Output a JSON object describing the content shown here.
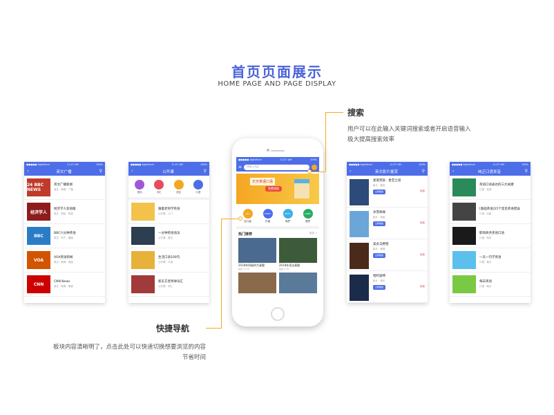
{
  "header": {
    "title": "首页页面展示",
    "subtitle": "HOME PAGE AND PAGE DISPLAY"
  },
  "annotations": {
    "search_title": "搜索",
    "search_desc_1": "用户可以在此输入关键词搜索或者开启语音输入",
    "search_desc_2": "极大提高搜索效率",
    "nav_title": "快捷导航",
    "nav_desc_1": "板块内容清晰明了，点击此处可以快速切换想要浏览的内容",
    "nav_desc_2": "节省时间"
  },
  "screen1": {
    "title": "英文广播",
    "status_left": "●●●●● Applelium",
    "status_time": "11:27 AM",
    "status_right": "100%",
    "items": [
      {
        "thumb": "24 BBC NEWS",
        "name": "英文广播新闻",
        "meta": "英文 · 新闻 · 广播",
        "color": "#c0392b"
      },
      {
        "thumb": "经济学人",
        "name": "经济学人双语版",
        "meta": "英文 · 财经 · 双语",
        "color": "#8e1c1c"
      },
      {
        "thumb": "BBC",
        "name": "BBC六分钟英语",
        "meta": "英文 · 听力 · 慢速",
        "color": "#2a7cc7"
      },
      {
        "thumb": "VOA",
        "name": "VOA英语新闻",
        "meta": "英文 · 新闻 · 常速",
        "color": "#d35400"
      },
      {
        "thumb": "CNN",
        "name": "CNN News",
        "meta": "英文 · 新闻 · 常速",
        "color": "#cc0000"
      }
    ]
  },
  "screen2": {
    "title": "公开课",
    "cats": [
      "音标",
      "词汇",
      "语法",
      "口语"
    ],
    "items": [
      {
        "name": "跟着老师学英语",
        "meta": "公开课 · 入门",
        "color": "#f3c24a"
      },
      {
        "name": "一分钟英语语法",
        "meta": "公开课 · 语法",
        "color": "#2c3e50"
      },
      {
        "name": "生活口语100句",
        "meta": "公开课 · 口语",
        "color": "#e8b13a"
      },
      {
        "name": "新东方老师讲词汇",
        "meta": "公开课 · 词汇",
        "color": "#a13a3a"
      }
    ]
  },
  "screen3": {
    "search_placeholder": "请输入内容",
    "quick": [
      {
        "short": "CET",
        "label": "四六级",
        "color": "#f5a623"
      },
      {
        "short": "TOEFL",
        "label": "托福",
        "color": "#4d6ee8"
      },
      {
        "short": "IELTS",
        "label": "雅思",
        "color": "#3ab0e8"
      },
      {
        "short": "LABEL",
        "label": "雅思",
        "color": "#27ae60"
      }
    ],
    "hot_title": "热门推荐",
    "hot_more": "更多 >",
    "hot": [
      {
        "caption": "2018年四级听力真题",
        "sub": "播放 12.5万",
        "color": "#4a6b8f"
      },
      {
        "caption": "2018年语法真题",
        "sub": "播放 9.8万",
        "color": "#3d5b3a"
      }
    ]
  },
  "screen4": {
    "title": "英文影片鉴赏",
    "items": [
      {
        "name": "星夜梵高 · 星空之谜",
        "meta": "影片 · 鉴赏",
        "color": "#2c4a7a"
      },
      {
        "name": "冰雪奇缘",
        "meta": "影片 · 动画",
        "color": "#6aa7d8"
      },
      {
        "name": "美女与野兽",
        "meta": "影片 · 爱情",
        "color": "#4a2a1a"
      },
      {
        "name": "哈利波特",
        "meta": "影片 · 奇幻",
        "color": "#1b2b4a"
      }
    ],
    "btn": "立即播放",
    "tag": "免费"
  },
  "screen5": {
    "title": "纯正口语发音",
    "items": [
      {
        "name": "英语口语表达的三大关键",
        "meta": "口语 · 发音",
        "color": "#2b8a5a"
      },
      {
        "name": "[基础英语]25个常见英语错误",
        "meta": "口语 · 纠错",
        "color": "#444"
      },
      {
        "name": "职场商务英语口语",
        "meta": "口语 · 商务",
        "color": "#1a1a1a"
      },
      {
        "name": "一天一句学英语",
        "meta": "口语 · 每日",
        "color": "#5bc0eb"
      },
      {
        "name": "每日英语",
        "meta": "口语 · 每日",
        "color": "#7ac943"
      }
    ]
  }
}
